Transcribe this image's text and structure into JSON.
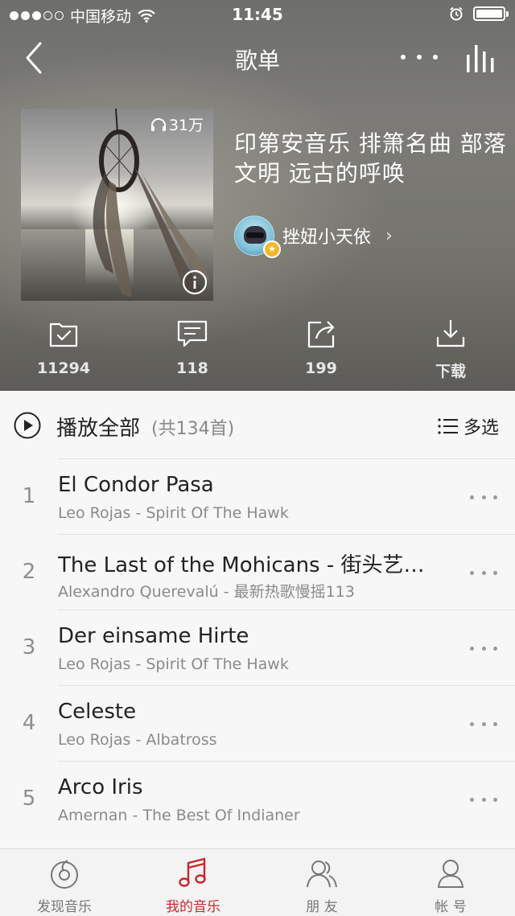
{
  "status_bar": {
    "carrier": "中国移动",
    "time": "11:45"
  },
  "nav": {
    "title": "歌单"
  },
  "playlist": {
    "play_count": "31万",
    "title": "印第安音乐 排箫名曲 部落文明 远古的呼唤",
    "creator": "挫妞小天依"
  },
  "actions": [
    {
      "label": "11294",
      "icon": "folder-check-icon"
    },
    {
      "label": "118",
      "icon": "comment-icon"
    },
    {
      "label": "199",
      "icon": "share-icon"
    },
    {
      "label": "下载",
      "icon": "download-icon"
    }
  ],
  "play_all": {
    "label": "播放全部",
    "count": "(共134首)",
    "multi_select": "多选"
  },
  "songs": [
    {
      "num": "1",
      "title": "El Condor Pasa",
      "subtitle": "Leo Rojas - Spirit Of The Hawk"
    },
    {
      "num": "2",
      "title": "The Last of the Mohicans - 街头艺…",
      "subtitle": "Alexandro Querevalú - 最新热歌慢摇113"
    },
    {
      "num": "3",
      "title": "Der einsame Hirte",
      "subtitle": "Leo Rojas - Spirit Of The Hawk"
    },
    {
      "num": "4",
      "title": "Celeste",
      "subtitle": "Leo Rojas - Albatross"
    },
    {
      "num": "5",
      "title": "Arco Iris",
      "subtitle": "Amernan - The Best Of Indianer"
    }
  ],
  "tabs": [
    {
      "label": "发现音乐",
      "icon": "discover-music-icon",
      "active": false
    },
    {
      "label": "我的音乐",
      "icon": "music-note-icon",
      "active": true
    },
    {
      "label": "朋 友",
      "icon": "friends-icon",
      "active": false
    },
    {
      "label": "帐 号",
      "icon": "account-icon",
      "active": false
    }
  ],
  "colors": {
    "accent": "#c8262c",
    "text_primary": "#222222",
    "text_secondary": "#8a8a8c"
  }
}
